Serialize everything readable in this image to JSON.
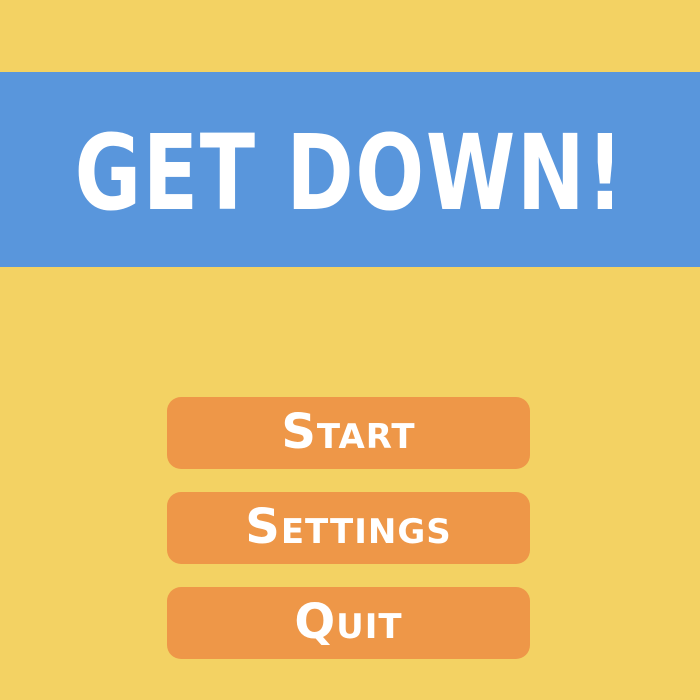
{
  "game": {
    "title": "GET DOWN!"
  },
  "menu": {
    "items": [
      {
        "label": "Start"
      },
      {
        "label": "Settings"
      },
      {
        "label": "Quit"
      }
    ]
  },
  "colors": {
    "background": "#F3D263",
    "banner": "#5996DC",
    "button": "#EE9748",
    "text": "#FFFFFF"
  }
}
